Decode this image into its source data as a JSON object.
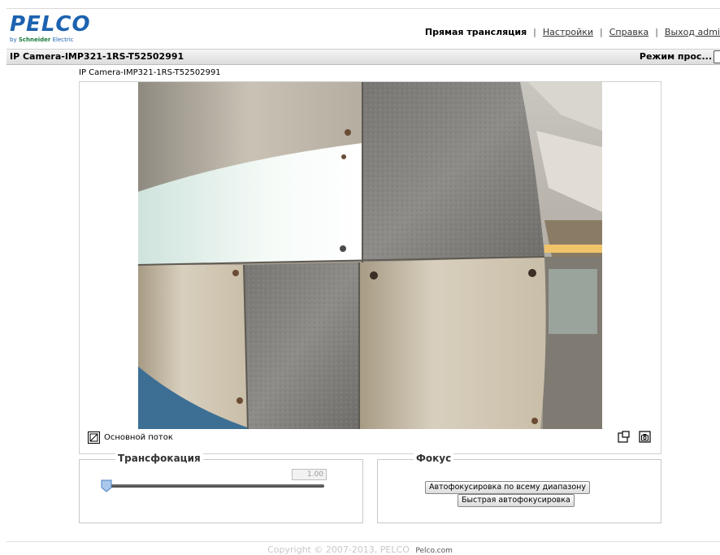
{
  "header": {
    "logo_text": "PELCO",
    "logo_sub_prefix": "by",
    "logo_sub_brand": "Schneider",
    "logo_sub_suffix": "Electric",
    "nav": {
      "live": "Прямая трансляция",
      "settings": "Настройки",
      "help": "Справка",
      "logout": "Выход admi"
    }
  },
  "titlebar": {
    "camera_name": "IP Camera-IMP321-1RS-T52502991",
    "mode": "Режим прос..."
  },
  "viewport": {
    "label": "IP Camera-IMP321-1RS-T52502991",
    "stream_label": "Основной поток"
  },
  "zoom_panel": {
    "title": "Трансфокация",
    "value": "1.00",
    "slider_fraction": 0.0
  },
  "focus_panel": {
    "title": "Фокус",
    "autofocus_full": "Автофокусировка по всему диапазону",
    "autofocus_quick": "Быстрая автофокусировка"
  },
  "footer": {
    "copyright": "Copyright © 2007-2013, PELCO",
    "link": "Pelco.com"
  },
  "colors": {
    "brand": "#1c62b0"
  }
}
